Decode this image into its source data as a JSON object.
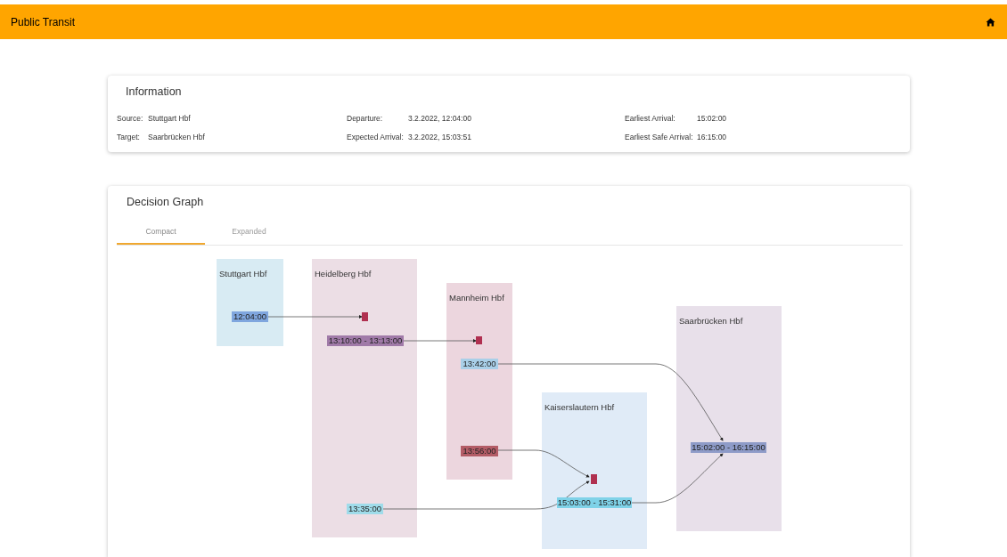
{
  "app_bar": {
    "title": "Public Transit"
  },
  "information": {
    "title": "Information",
    "fields": [
      {
        "label": "Source:",
        "value": "Stuttgart Hbf"
      },
      {
        "label": "Departure:",
        "value": "3.2.2022, 12:04:00"
      },
      {
        "label": "Earliest Arrival:",
        "value": "15:02:00"
      },
      {
        "label": "Target:",
        "value": "Saarbrücken Hbf"
      },
      {
        "label": "Expected Arrival:",
        "value": "3.2.2022, 15:03:51"
      },
      {
        "label": "Earliest Safe Arrival:",
        "value": "16:15:00"
      }
    ]
  },
  "decision_graph": {
    "title": "Decision Graph",
    "tabs": [
      {
        "label": "Compact",
        "selected": true
      },
      {
        "label": "Expanded",
        "selected": false
      }
    ],
    "stations": [
      {
        "name": "Stuttgart Hbf",
        "color": "#d8ebf3"
      },
      {
        "name": "Heidelberg Hbf",
        "color": "#ecdee5"
      },
      {
        "name": "Mannheim Hbf",
        "color": "#ecd6de"
      },
      {
        "name": "Kaiserslautern Hbf",
        "color": "#e0ebf7"
      },
      {
        "name": "Saarbrücken Hbf",
        "color": "#e8e0ea"
      }
    ],
    "time_nodes": [
      {
        "label": "12:04:00",
        "color": "#7fa6de"
      },
      {
        "label": "13:10:00 - 13:13:00",
        "color": "#a07aa8"
      },
      {
        "label": "13:42:00",
        "color": "#a9cfe8"
      },
      {
        "label": "13:56:00",
        "color": "#b35c66"
      },
      {
        "label": "13:35:00",
        "color": "#9fdcea"
      },
      {
        "label": "15:03:00 - 15:31:00",
        "color": "#7fd2e8"
      },
      {
        "label": "15:02:00 - 16:15:00",
        "color": "#8e9bc8"
      }
    ]
  }
}
